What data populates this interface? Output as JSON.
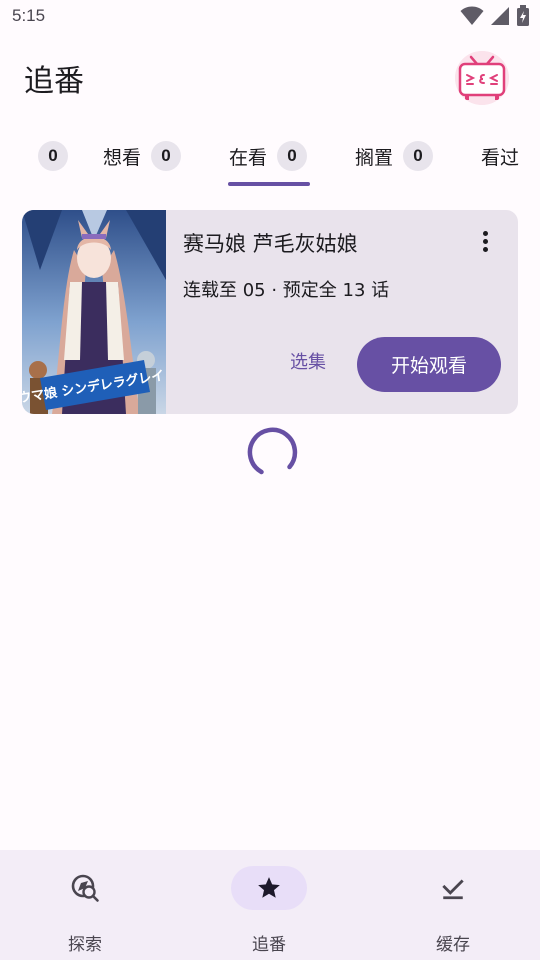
{
  "status_bar": {
    "time": "5:15"
  },
  "header": {
    "title": "追番"
  },
  "tabs": [
    {
      "label": "",
      "count": "0"
    },
    {
      "label": "想看",
      "count": "0"
    },
    {
      "label": "在看",
      "count": "0"
    },
    {
      "label": "搁置",
      "count": "0"
    },
    {
      "label": "看过",
      "count": ""
    }
  ],
  "selected_tab": "在看",
  "card": {
    "title": "赛马娘 芦毛灰姑娘",
    "progress": "连载至 05 · 预定全 13 话",
    "select_episode_label": "选集",
    "watch_label": "开始观看",
    "cover_art_text": "ウマ娘 シンデレラグレイ"
  },
  "bottom_nav": {
    "items": [
      {
        "label": "探索",
        "icon": "explore-search-icon"
      },
      {
        "label": "追番",
        "icon": "star-icon"
      },
      {
        "label": "缓存",
        "icon": "download-done-icon"
      }
    ],
    "active": "追番"
  },
  "colors": {
    "primary": "#6750a4",
    "surface": "#fffbfe",
    "card": "#e9e3ec",
    "nav_background": "#f3edf7",
    "active_pill": "#e8def8",
    "chip": "#e8e4ec"
  }
}
